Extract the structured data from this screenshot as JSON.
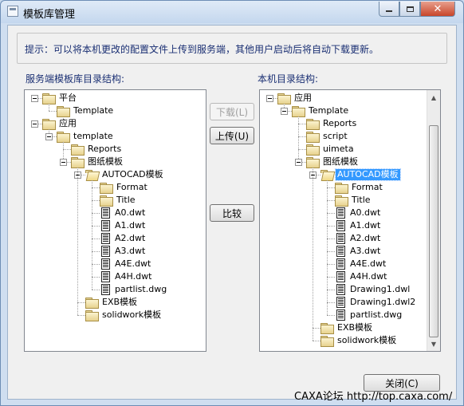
{
  "window": {
    "title": "模板库管理",
    "close_glyph": "✕"
  },
  "hint": "提示：可以将本机更改的配置文件上传到服务端，其他用户启动后将自动下载更新。",
  "left_label": "服务端模板库目录结构:",
  "right_label": "本机目录结构:",
  "buttons": {
    "download": "下载(L)",
    "upload": "上传(U)",
    "compare": "比较",
    "close": "关闭(C)"
  },
  "left_tree": [
    {
      "label": "平台",
      "icon": "folder-icon",
      "level": 0,
      "expander": true
    },
    {
      "label": "Template",
      "icon": "folder-icon",
      "level": 1
    },
    {
      "label": "应用",
      "icon": "folder-icon",
      "level": 0,
      "expander": true
    },
    {
      "label": "template",
      "icon": "folder-icon",
      "level": 1,
      "expander": true
    },
    {
      "label": "Reports",
      "icon": "folder-icon",
      "level": 2
    },
    {
      "label": "图纸模板",
      "icon": "folder-icon",
      "level": 2,
      "expander": true
    },
    {
      "label": "AUTOCAD模板",
      "icon": "folder-open-icon",
      "level": 3,
      "expander": true
    },
    {
      "label": "Format",
      "icon": "folder-icon",
      "level": 4
    },
    {
      "label": "Title",
      "icon": "folder-icon",
      "level": 4
    },
    {
      "label": "A0.dwt",
      "icon": "file-icon",
      "level": 4
    },
    {
      "label": "A1.dwt",
      "icon": "file-icon",
      "level": 4
    },
    {
      "label": "A2.dwt",
      "icon": "file-icon",
      "level": 4
    },
    {
      "label": "A3.dwt",
      "icon": "file-icon",
      "level": 4
    },
    {
      "label": "A4E.dwt",
      "icon": "file-icon",
      "level": 4
    },
    {
      "label": "A4H.dwt",
      "icon": "file-icon",
      "level": 4
    },
    {
      "label": "partlist.dwg",
      "icon": "file-icon",
      "level": 4
    },
    {
      "label": "EXB模板",
      "icon": "folder-icon",
      "level": 3
    },
    {
      "label": "solidwork模板",
      "icon": "folder-icon",
      "level": 3
    }
  ],
  "right_tree": [
    {
      "label": "应用",
      "icon": "folder-icon",
      "level": 0,
      "expander": true
    },
    {
      "label": "Template",
      "icon": "folder-icon",
      "level": 1,
      "expander": true
    },
    {
      "label": "Reports",
      "icon": "folder-icon",
      "level": 2
    },
    {
      "label": "script",
      "icon": "folder-icon",
      "level": 2
    },
    {
      "label": "uimeta",
      "icon": "folder-icon",
      "level": 2
    },
    {
      "label": "图纸模板",
      "icon": "folder-icon",
      "level": 2,
      "expander": true
    },
    {
      "label": "AUTOCAD模板",
      "icon": "folder-open-icon",
      "level": 3,
      "expander": true,
      "selected": true
    },
    {
      "label": "Format",
      "icon": "folder-icon",
      "level": 4
    },
    {
      "label": "Title",
      "icon": "folder-icon",
      "level": 4
    },
    {
      "label": "A0.dwt",
      "icon": "file-icon",
      "level": 4
    },
    {
      "label": "A1.dwt",
      "icon": "file-icon",
      "level": 4
    },
    {
      "label": "A2.dwt",
      "icon": "file-icon",
      "level": 4
    },
    {
      "label": "A3.dwt",
      "icon": "file-icon",
      "level": 4
    },
    {
      "label": "A4E.dwt",
      "icon": "file-icon",
      "level": 4
    },
    {
      "label": "A4H.dwt",
      "icon": "file-icon",
      "level": 4
    },
    {
      "label": "Drawing1.dwl",
      "icon": "file-icon",
      "level": 4
    },
    {
      "label": "Drawing1.dwl2",
      "icon": "file-icon",
      "level": 4
    },
    {
      "label": "partlist.dwg",
      "icon": "file-icon",
      "level": 4
    },
    {
      "label": "EXB模板",
      "icon": "folder-icon",
      "level": 3
    },
    {
      "label": "solidwork模板",
      "icon": "folder-icon",
      "level": 3
    }
  ],
  "scrollbar_icons": {
    "up": "scroll-up-arrow-icon",
    "down": "scroll-down-arrow-icon"
  },
  "watermark": "CAXA论坛  http://top.caxa.com/",
  "colors": {
    "selection": "#3399ff",
    "label_text": "#1a2f73"
  }
}
